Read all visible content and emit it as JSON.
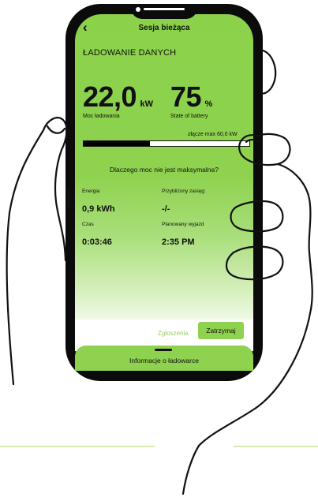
{
  "header": {
    "back_icon": "chevron-left-icon",
    "title": "Sesja bieżąca"
  },
  "section_title": "ŁADOWANIE DANYCH",
  "power": {
    "value": "22,0",
    "unit": "kW",
    "label": "Moc ładowania"
  },
  "battery": {
    "value": "75",
    "unit": "%",
    "label": "State of battery"
  },
  "connector_max": "złącze max 60,0 kW",
  "progress": {
    "fraction": 0.4
  },
  "question_link": "Dlaczego moc nie jest maksymalna?",
  "stats": {
    "energy": {
      "label": "Energia",
      "value": "0,9 kWh"
    },
    "range": {
      "label": "Przybliżony zasięg:",
      "value": "-/-"
    },
    "time": {
      "label": "Czas",
      "value": "0:03:46"
    },
    "departure": {
      "label": "Planowany wyjazd",
      "value": "2:35 PM"
    }
  },
  "actions": {
    "report": "Zgłoszenia",
    "stop": "Zatrzymaj"
  },
  "drawer": {
    "label": "Informacje o ładowarce"
  },
  "colors": {
    "accent": "#8ed24f",
    "accent_light": "#c9e69a",
    "text": "#111111"
  }
}
